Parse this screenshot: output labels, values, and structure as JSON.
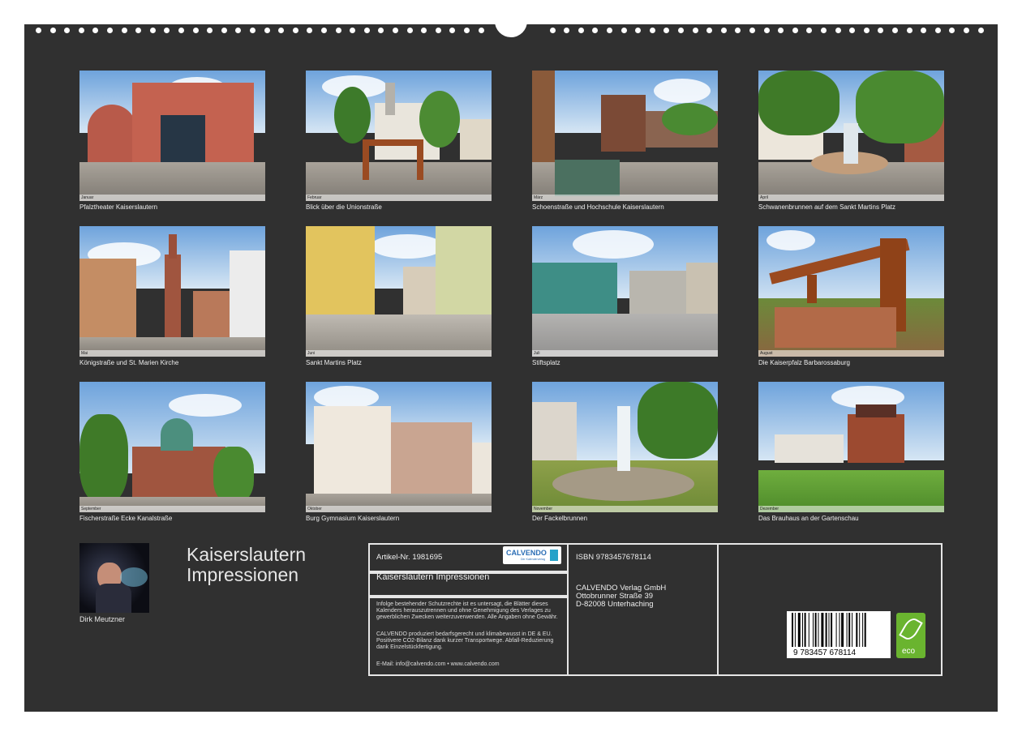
{
  "calendar": {
    "title_line1": "Kaiserslautern",
    "title_line2": "Impressionen",
    "author": "Dirk Meutzner"
  },
  "photos": [
    {
      "caption": "Pfalztheater Kaiserslautern",
      "month": "Januar"
    },
    {
      "caption": "Blick über die Unionstraße",
      "month": "Februar"
    },
    {
      "caption": "Schoenstraße und Hochschule Kaiserslautern",
      "month": "März"
    },
    {
      "caption": "Schwanenbrunnen auf dem Sankt Martins Platz",
      "month": "April"
    },
    {
      "caption": "Königstraße und St. Marien Kirche",
      "month": "Mai"
    },
    {
      "caption": "Sankt Martins Platz",
      "month": "Juni"
    },
    {
      "caption": "Stiftsplatz",
      "month": "Juli"
    },
    {
      "caption": "Die Kaiserpfalz Barbarossaburg",
      "month": "August"
    },
    {
      "caption": "Fischerstraße Ecke Kanalstraße",
      "month": "September"
    },
    {
      "caption": "Burg Gymnasium Kaiserslautern",
      "month": "Oktober"
    },
    {
      "caption": "Der Fackelbrunnen",
      "month": "November"
    },
    {
      "caption": "Das Brauhaus an der Gartenschau",
      "month": "Dezember"
    }
  ],
  "info": {
    "article_no": "Artikel-Nr. 1981695",
    "product_title": "Kaiserslautern Impressionen",
    "copyright_text": "Infolge bestehender Schutzrechte ist es untersagt, die Blätter dieses Kalenders herauszutrennen und ohne Genehmigung des Verlages zu gewerblichen Zwecken weiterzuverwenden. Alle Angaben ohne Gewähr.",
    "eco_text": "CALVENDO produziert bedarfsgerecht und klimabewusst in DE & EU. Positivere CO2-Bilanz dank kurzer Transportwege. Abfall-Reduzierung dank Einzelstückfertigung.",
    "contact": "E-Mail: info@calvendo.com • www.calvendo.com",
    "isbn": "ISBN 9783457678114",
    "publisher": "CALVENDO Verlag GmbH",
    "street": "Ottobrunner Straße 39",
    "city": "D-82008 Unterhaching",
    "barcode_number": "9 783457 678114",
    "logo_text": "CALVENDO",
    "logo_subtext": "Der Kalenderverlag",
    "eco_badge": "eco"
  },
  "colors": {
    "background": "#303030",
    "frame": "#e6e6e6",
    "text": "#eeeeee",
    "eco_green": "#6ab42f",
    "logo_blue": "#2a6db5"
  }
}
